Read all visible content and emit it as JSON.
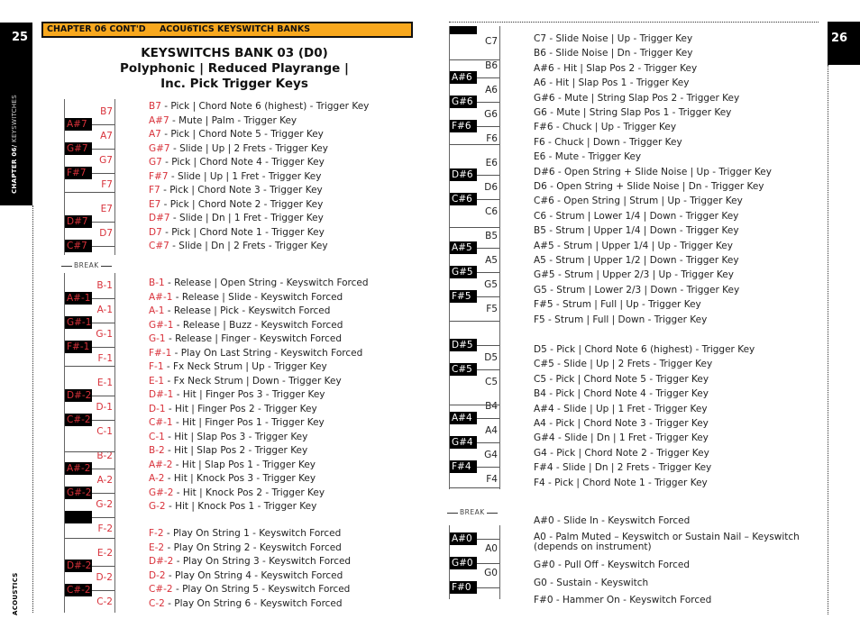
{
  "left_page": {
    "page_number": "25",
    "side_label_bold": "CHAPTER 06/",
    "side_label_light": " KEYSWITCHES",
    "footer_label": "ACOUSTICS",
    "banner": {
      "chapter": "CHAPTER 06 CONT'D",
      "section": "ACOU6TICS KEYSWITCH BANKS"
    },
    "title_lines": [
      "KEYSWITCHS BANK 03 (D0)",
      "Polyphonic | Reduced Playrange |",
      "Inc. Pick Trigger Keys"
    ],
    "break_label": "BREAK",
    "keyboard_upper": {
      "white_keys": [
        "B7",
        "A7",
        "G7",
        "F7",
        "E7",
        "D7"
      ],
      "black_keys": [
        "A#7",
        "G#7",
        "F#7",
        "D#7",
        "C#7"
      ]
    },
    "keyboard_lower": {
      "white_keys": [
        "B-1",
        "A-1",
        "G-1",
        "F-1",
        "E-1",
        "D-1",
        "C-1",
        "B-2",
        "A-2",
        "G-2",
        "F-2",
        "E-2",
        "D-2",
        "C-2"
      ],
      "black_keys": [
        "A#-1",
        "G#-1",
        "F#-1",
        "D#-2",
        "C#-2",
        "A#-2",
        "G#-2",
        "",
        "D#-2",
        "C#-2"
      ]
    },
    "entries_upper": [
      {
        "note": "B7",
        "text": " - Pick | Chord Note 6 (highest) - Trigger Key"
      },
      {
        "note": "A#7",
        "text": " - Mute | Palm - Trigger Key"
      },
      {
        "note": "A7",
        "text": " - Pick | Chord Note 5 - Trigger Key"
      },
      {
        "note": "G#7",
        "text": " - Slide | Up | 2 Frets - Trigger Key"
      },
      {
        "note": "G7",
        "text": " - Pick | Chord Note 4 - Trigger Key"
      },
      {
        "note": "F#7",
        "text": " - Slide | Up | 1 Fret - Trigger Key"
      },
      {
        "note": "F7",
        "text": " - Pick | Chord Note 3 - Trigger Key"
      },
      {
        "note": "E7",
        "text": " - Pick | Chord Note 2 - Trigger Key"
      },
      {
        "note": "D#7",
        "text": " - Slide | Dn | 1 Fret - Trigger Key"
      },
      {
        "note": "D7",
        "text": " - Pick | Chord Note 1 - Trigger Key"
      },
      {
        "note": "C#7",
        "text": " - Slide | Dn | 2 Frets - Trigger Key"
      }
    ],
    "entries_lower": [
      {
        "note": "B-1",
        "text": " - Release | Open String - Keyswitch Forced"
      },
      {
        "note": "A#-1",
        "text": " - Release | Slide - Keyswitch Forced"
      },
      {
        "note": "A-1",
        "text": " - Release | Pick - Keyswitch Forced"
      },
      {
        "note": "G#-1",
        "text": " - Release | Buzz - Keyswitch Forced"
      },
      {
        "note": "G-1",
        "text": " - Release | Finger - Keyswitch Forced"
      },
      {
        "note": "F#-1",
        "text": " - Play On Last String - Keyswitch Forced"
      },
      {
        "note": "F-1",
        "text": " - Fx Neck Strum | Up - Trigger Key"
      },
      {
        "note": "E-1",
        "text": " - Fx Neck Strum | Down - Trigger Key"
      },
      {
        "note": "D#-1",
        "text": " - Hit | Finger Pos 3 - Trigger Key"
      },
      {
        "note": "D-1",
        "text": " - Hit | Finger Pos 2 - Trigger Key"
      },
      {
        "note": "C#-1",
        "text": " - Hit | Finger Pos 1 - Trigger Key"
      },
      {
        "note": "C-1",
        "text": " - Hit | Slap Pos 3 - Trigger Key"
      },
      {
        "note": "B-2",
        "text": " - Hit | Slap Pos 2 - Trigger Key"
      },
      {
        "note": "A#-2",
        "text": " - Hit | Slap Pos 1 - Trigger Key"
      },
      {
        "note": "A-2",
        "text": " - Hit | Knock Pos 3 - Trigger Key"
      },
      {
        "note": "G#-2",
        "text": " - Hit | Knock Pos 2 - Trigger Key"
      },
      {
        "note": "G-2",
        "text": " - Hit | Knock Pos 1 - Trigger Key"
      }
    ],
    "entries_bottom": [
      {
        "note": "F-2",
        "text": " - Play On String 1 - Keyswitch Forced"
      },
      {
        "note": "E-2",
        "text": " - Play On String 2 - Keyswitch Forced"
      },
      {
        "note": "D#-2",
        "text": " - Play On String 3 - Keyswitch Forced"
      },
      {
        "note": "D-2",
        "text": " - Play On String 4 - Keyswitch Forced"
      },
      {
        "note": "C#-2",
        "text": " - Play On String 5 - Keyswitch Forced"
      },
      {
        "note": "C-2",
        "text": " - Play On String 6 - Keyswitch Forced"
      }
    ]
  },
  "right_page": {
    "page_number": "26",
    "break_label": "BREAK",
    "keyboard_upper": {
      "white_keys": [
        "C7",
        "B6",
        "A6",
        "G6",
        "F6",
        "E6",
        "D6",
        "C6",
        "B5",
        "A5",
        "G5",
        "F5",
        "D5",
        "C5",
        "B4",
        "A4",
        "G4",
        "F4"
      ],
      "black_keys": [
        "A#6",
        "G#6",
        "F#6",
        "D#6",
        "C#6",
        "A#5",
        "G#5",
        "F#5",
        "D#5",
        "C#5",
        "A#4",
        "G#4",
        "F#4"
      ]
    },
    "keyboard_lower": {
      "white_keys": [
        "A0",
        "G0"
      ],
      "black_keys": [
        "A#0",
        "G#0",
        "F#0"
      ]
    },
    "entries_upper": [
      "C7 - Slide Noise | Up - Trigger Key",
      "B6 - Slide Noise | Dn - Trigger Key",
      "A#6 - Hit | Slap Pos 2 - Trigger Key",
      "A6 - Hit | Slap Pos 1 - Trigger Key",
      "G#6 - Mute | String Slap Pos 2 - Trigger Key",
      "G6 - Mute | String Slap Pos 1 - Trigger Key",
      "F#6 - Chuck | Up - Trigger Key",
      "F6 - Chuck | Down - Trigger Key",
      "E6 - Mute - Trigger Key",
      "D#6 - Open String + Slide Noise | Up - Trigger Key",
      "D6 - Open String + Slide Noise | Dn - Trigger Key",
      "C#6 - Open String | Strum | Up - Trigger Key",
      "C6 - Strum | Lower 1/4 | Down - Trigger Key",
      "B5 - Strum | Upper 1/4 | Down - Trigger Key",
      "A#5 - Strum | Upper 1/4 | Up - Trigger Key",
      "A5 - Strum | Upper 1/2 | Down - Trigger Key",
      "G#5 - Strum | Upper 2/3 | Up - Trigger Key",
      "G5 - Strum | Lower 2/3 | Down - Trigger Key",
      "F#5 - Strum | Full | Up - Trigger Key",
      "F5 - Strum | Full | Down - Trigger Key"
    ],
    "entries_middle": [
      "D5 - Pick | Chord Note 6 (highest) - Trigger Key",
      "C#5 - Slide | Up | 2 Frets - Trigger Key",
      "C5 - Pick | Chord Note 5 - Trigger Key",
      "B4 - Pick | Chord Note 4 - Trigger Key",
      "A#4 - Slide | Up | 1 Fret - Trigger Key",
      "A4 - Pick | Chord Note 3 - Trigger Key",
      "G#4 - Slide | Dn | 1 Fret - Trigger Key",
      "G4 - Pick | Chord Note 2 - Trigger Key",
      "F#4 - Slide | Dn | 2 Frets - Trigger Key",
      "F4 - Pick | Chord Note 1 - Trigger Key"
    ],
    "entries_bottom": [
      "A#0 - Slide In - Keyswitch Forced",
      "A0 - Palm Muted – Keyswitch or Sustain Nail – Keyswitch (depends on instrument)",
      "G#0 - Pull Off - Keyswitch Forced",
      "G0 - Sustain - Keyswitch",
      "F#0 - Hammer On - Keyswitch Forced"
    ]
  },
  "colors": {
    "banner": "#f8a81e",
    "note_red": "#d8313a",
    "tab_black": "#000000"
  }
}
